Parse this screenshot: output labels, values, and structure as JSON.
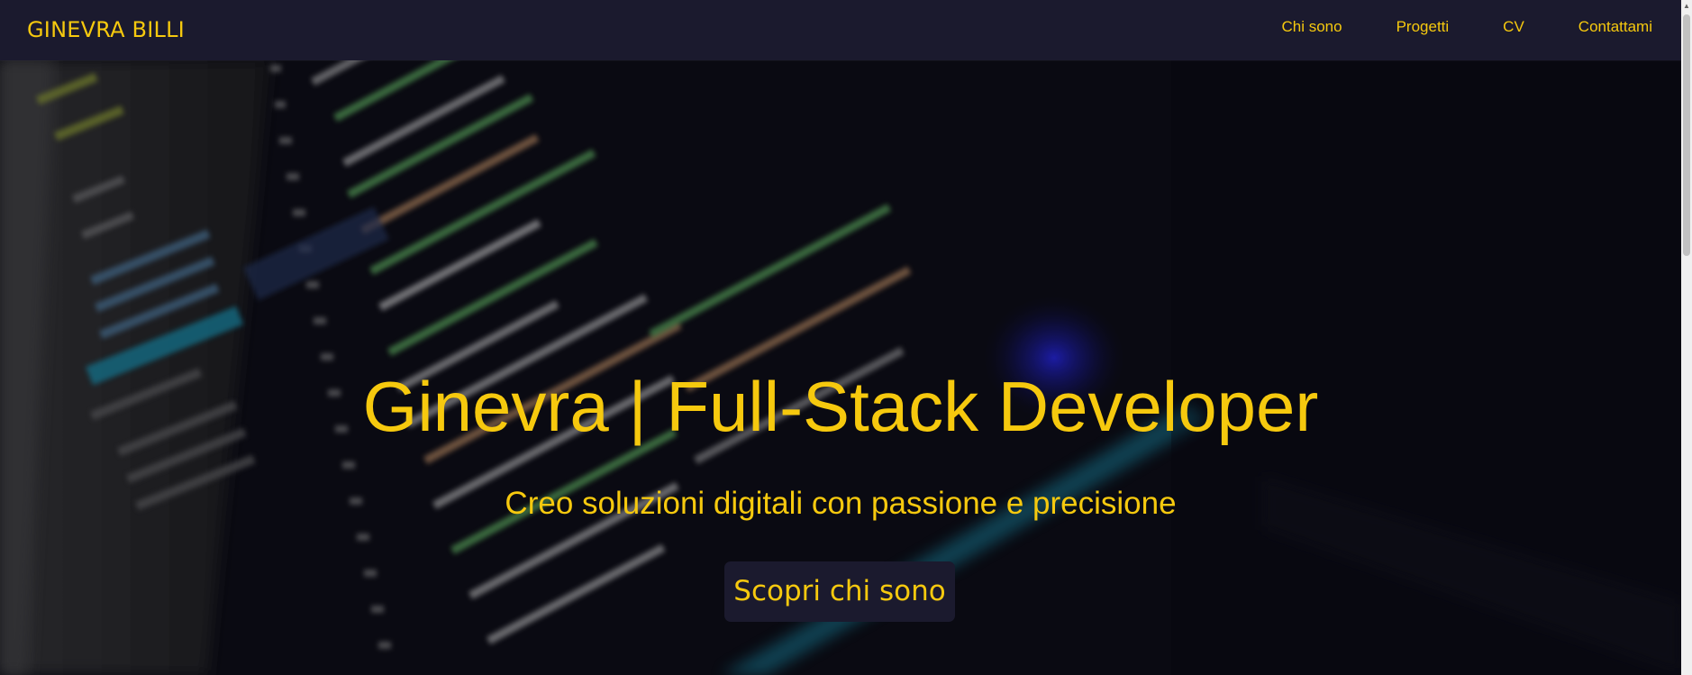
{
  "brand": "GINEVRA BILLI",
  "nav": {
    "items": [
      {
        "label": "Chi sono"
      },
      {
        "label": "Progetti"
      },
      {
        "label": "CV"
      },
      {
        "label": "Contattami"
      }
    ]
  },
  "hero": {
    "title": "Ginevra | Full-Stack Developer",
    "subtitle": "Creo soluzioni digitali con passione e precisione",
    "button_label": "Scopri chi sono"
  },
  "colors": {
    "accent": "#f6c90e",
    "navbar_bg": "#1b1a2e",
    "button_bg": "#1b1a2e"
  },
  "icons": {
    "scroll_up": "triangle-up-icon"
  }
}
